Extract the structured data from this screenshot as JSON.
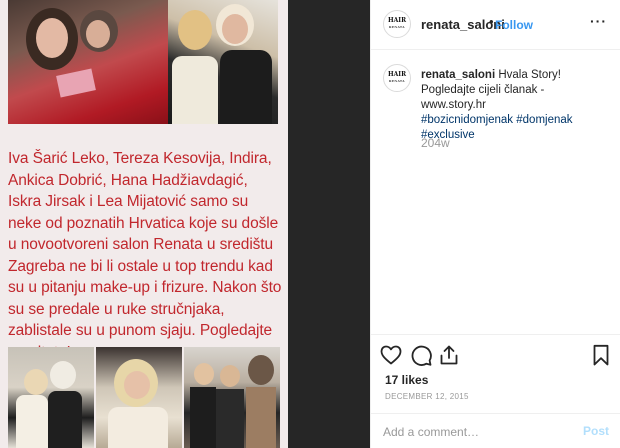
{
  "post": {
    "caption_image_text": "Iva Šarić Leko, Tereza Kesovija, Indira, Ankica Dobrić, Hana Hadžiavdagić, Iskra Jirsak i Lea Mijatović samo su neke od poznatih Hrvatica koje su došle u novootvoreni salon Renata u središtu Zagreba ne bi li ostale u top trendu kad su u pitanju make-up i frizure. Nakon što su se predale u ruke stručnjaka, zablistale su u punom sjaju. Pogledajte rezultate!"
  },
  "header": {
    "avatar_logo": "HAIR",
    "avatar_logo_sub": "RENATA",
    "username": "renata_saloni",
    "dot": "•",
    "follow_label": "Follow",
    "more_label": "···"
  },
  "comment": {
    "username": "renata_saloni",
    "text": "Hvala Story! Pogledajte cijeli članak - www.story.hr",
    "hashtags": [
      "#bozicnidomjenak",
      "#domjenak",
      "#exclusive"
    ],
    "time": "204w"
  },
  "actions": {
    "likes": "17 likes",
    "date": "DECEMBER 12, 2015"
  },
  "comment_box": {
    "placeholder": "Add a comment…",
    "post_label": "Post"
  },
  "colors": {
    "caption_red": "#c1272d",
    "link_blue": "#3897f0",
    "hashtag_blue": "#003569",
    "muted_gray": "#999999",
    "gutter_dark": "#262626"
  }
}
